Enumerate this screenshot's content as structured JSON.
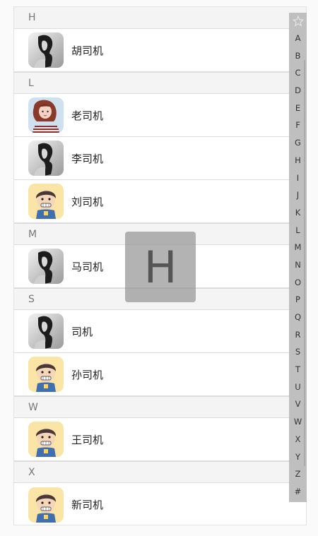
{
  "sections": [
    {
      "letter": "H",
      "contacts": [
        {
          "name": "胡司机",
          "avatar": "bw-girl-avatar"
        }
      ]
    },
    {
      "letter": "L",
      "contacts": [
        {
          "name": "老司机",
          "avatar": "color-girl-avatar"
        },
        {
          "name": "李司机",
          "avatar": "bw-girl-avatar"
        },
        {
          "name": "刘司机",
          "avatar": "cartoon-boy-avatar"
        }
      ]
    },
    {
      "letter": "M",
      "contacts": [
        {
          "name": "马司机",
          "avatar": "bw-girl-avatar"
        }
      ]
    },
    {
      "letter": "S",
      "contacts": [
        {
          "name": "司机",
          "avatar": "bw-girl-avatar"
        },
        {
          "name": "孙司机",
          "avatar": "cartoon-boy-avatar"
        }
      ]
    },
    {
      "letter": "W",
      "contacts": [
        {
          "name": "王司机",
          "avatar": "cartoon-boy-avatar"
        }
      ]
    },
    {
      "letter": "X",
      "contacts": [
        {
          "name": "新司机",
          "avatar": "cartoon-boy-avatar"
        }
      ]
    }
  ],
  "index_bar": {
    "star_icon": "star-icon",
    "letters": [
      "A",
      "B",
      "C",
      "D",
      "E",
      "F",
      "G",
      "H",
      "I",
      "J",
      "K",
      "L",
      "M",
      "N",
      "O",
      "P",
      "Q",
      "R",
      "S",
      "T",
      "U",
      "V",
      "W",
      "X",
      "Y",
      "Z",
      "#"
    ]
  },
  "overlay_letter": "H",
  "colors": {
    "header_bg": "#f4f4f4",
    "index_bar_bg": "#bfbfbf",
    "overlay_bg": "#969696"
  }
}
